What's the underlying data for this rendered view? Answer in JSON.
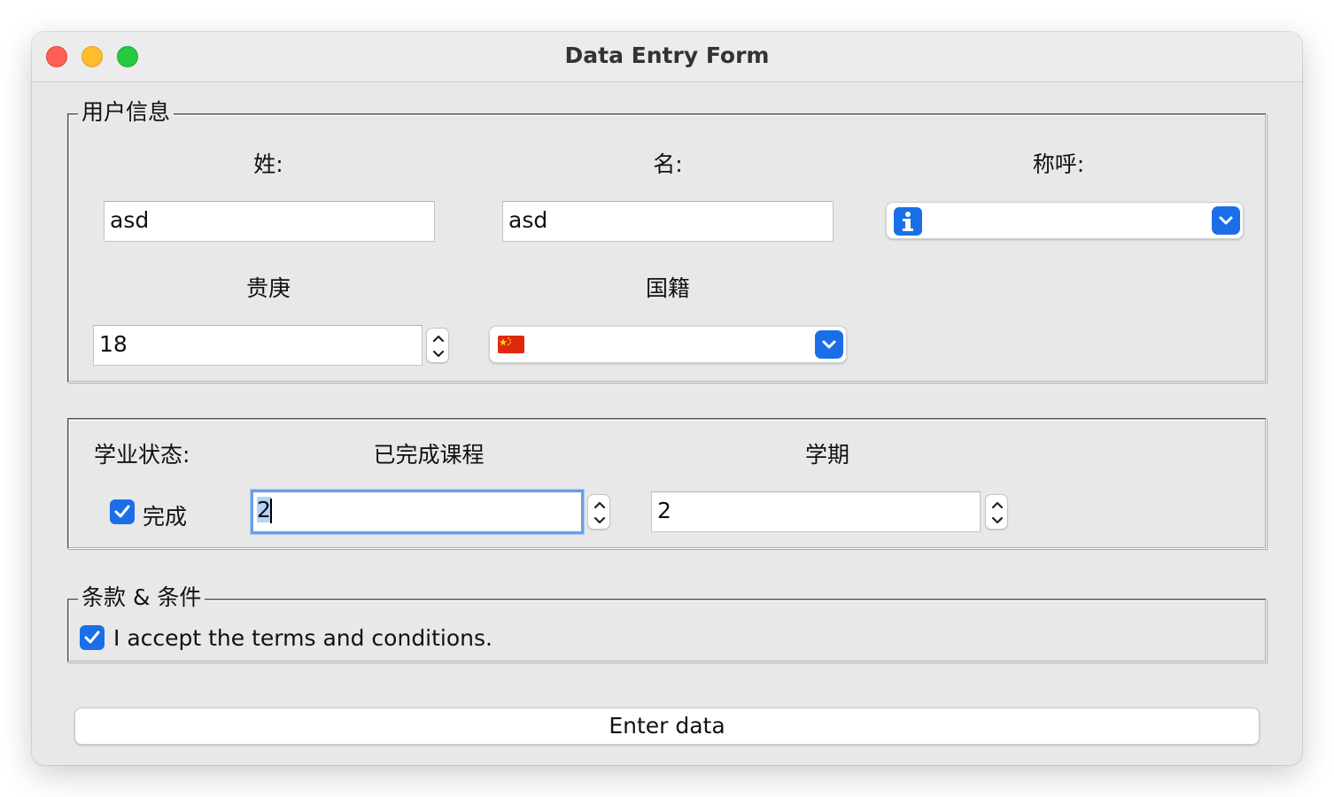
{
  "window": {
    "title": "Data Entry Form"
  },
  "user_info": {
    "legend": "用户信息",
    "first_name_label": "姓:",
    "last_name_label": "名:",
    "title_label": "称呼:",
    "first_name_value": "asd",
    "last_name_value": "asd",
    "title_icon": "information-icon",
    "age_label": "贵庚",
    "age_value": "18",
    "nationality_label": "国籍",
    "nationality_icon": "china-flag-icon"
  },
  "courses": {
    "status_label": "学业状态:",
    "completed_courses_label": "已完成课程",
    "semester_label": "学期",
    "completed_checkbox_label": "完成",
    "completed_checked": true,
    "completed_courses_value": "2",
    "semester_value": "2"
  },
  "terms": {
    "legend": "条款 & 条件",
    "accept_label": "I accept the terms and conditions.",
    "accepted": true
  },
  "actions": {
    "enter_label": "Enter data"
  },
  "colors": {
    "accent": "#1a6fe8",
    "focus_ring": "#6a9de8",
    "selection": "#b3d3fb"
  }
}
